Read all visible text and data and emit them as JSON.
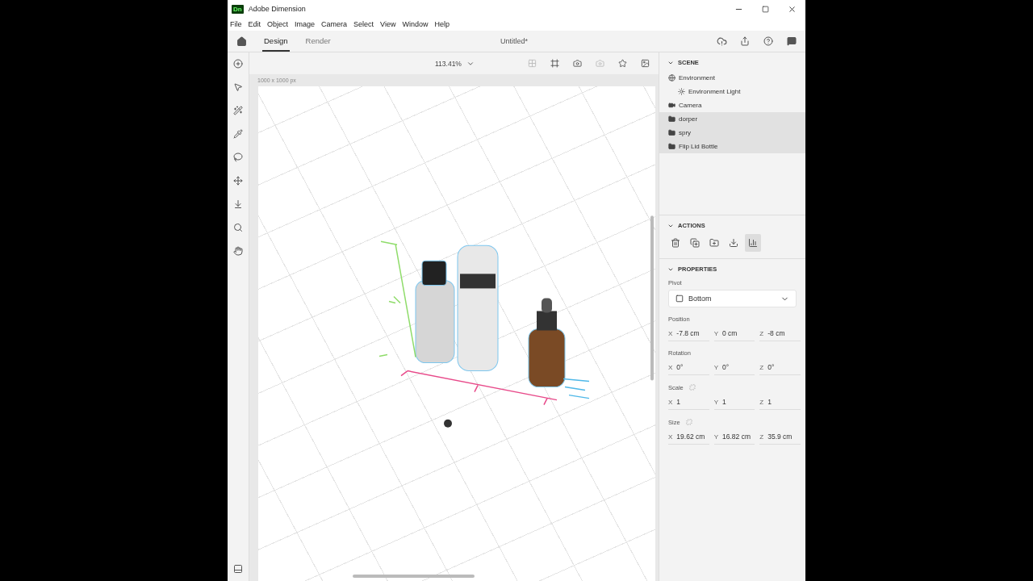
{
  "window": {
    "title": "Adobe Dimension",
    "app_badge": "Dn"
  },
  "menu": [
    "File",
    "Edit",
    "Object",
    "Image",
    "Camera",
    "Select",
    "View",
    "Window",
    "Help"
  ],
  "tabs": [
    {
      "label": "Design",
      "selected": true
    },
    {
      "label": "Render",
      "selected": false
    }
  ],
  "document_title": "Untitled*",
  "canvas": {
    "zoom": "113.41%",
    "size_label": "1000 x 1000 px"
  },
  "scene": {
    "title": "SCENE",
    "items": [
      {
        "label": "Environment",
        "kind": "environment",
        "selected": false,
        "children": [
          {
            "label": "Environment Light",
            "kind": "light",
            "selected": false
          }
        ]
      },
      {
        "label": "Camera",
        "kind": "camera",
        "selected": false
      },
      {
        "label": "dorper",
        "kind": "group",
        "selected": true
      },
      {
        "label": "spry",
        "kind": "group",
        "selected": true
      },
      {
        "label": "Flip Lid Bottle",
        "kind": "group",
        "selected": true
      }
    ]
  },
  "actions": {
    "title": "ACTIONS"
  },
  "properties": {
    "title": "PROPERTIES",
    "pivot": {
      "label": "Pivot",
      "value": "Bottom"
    },
    "groups": [
      {
        "label": "Position",
        "kind": "plain",
        "fields": [
          {
            "axis": "X",
            "value": "-7.8 cm"
          },
          {
            "axis": "Y",
            "value": "0 cm"
          },
          {
            "axis": "Z",
            "value": "-8 cm"
          }
        ]
      },
      {
        "label": "Rotation",
        "kind": "plain",
        "fields": [
          {
            "axis": "X",
            "value": "0°"
          },
          {
            "axis": "Y",
            "value": "0°"
          },
          {
            "axis": "Z",
            "value": "0°"
          }
        ]
      },
      {
        "label": "Scale",
        "kind": "linkable",
        "fields": [
          {
            "axis": "X",
            "value": "1"
          },
          {
            "axis": "Y",
            "value": "1"
          },
          {
            "axis": "Z",
            "value": "1"
          }
        ]
      },
      {
        "label": "Size",
        "kind": "linkable",
        "fields": [
          {
            "axis": "X",
            "value": "19.62 cm"
          },
          {
            "axis": "Y",
            "value": "16.82 cm"
          },
          {
            "axis": "Z",
            "value": "35.9 cm"
          }
        ]
      }
    ]
  }
}
